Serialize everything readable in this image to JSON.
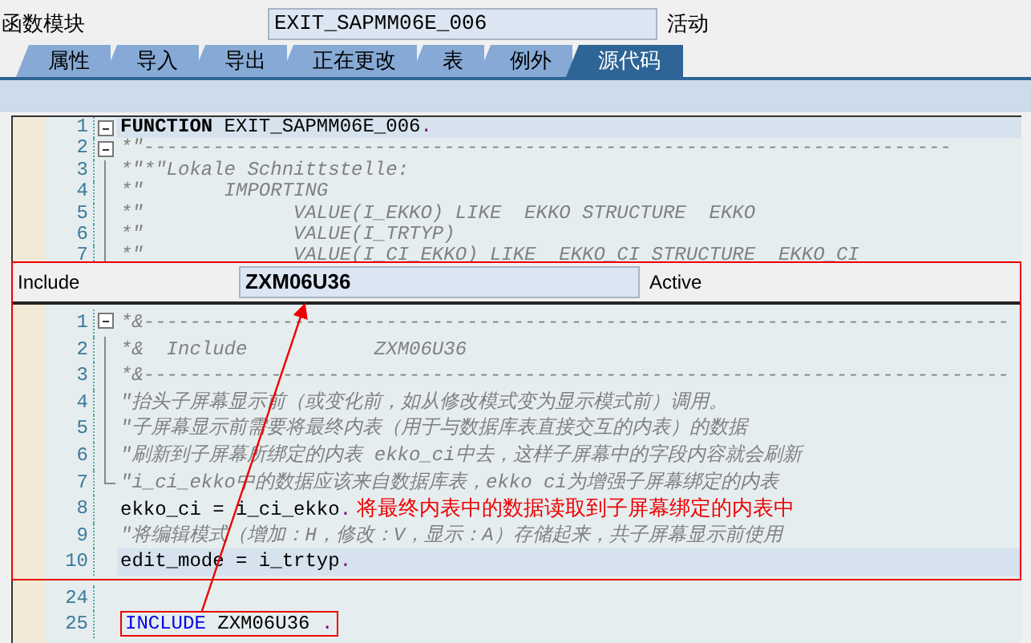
{
  "header": {
    "label": "函数模块",
    "value": "EXIT_SAPMM06E_006",
    "status": "活动"
  },
  "tabs": [
    {
      "label": "属性",
      "selected": false
    },
    {
      "label": "导入",
      "selected": false
    },
    {
      "label": "导出",
      "selected": false
    },
    {
      "label": "正在更改",
      "selected": false
    },
    {
      "label": "表",
      "selected": false
    },
    {
      "label": "例外",
      "selected": false
    },
    {
      "label": "源代码",
      "selected": true
    }
  ],
  "editor": {
    "lines": [
      {
        "number": "1",
        "kind": "foldstart",
        "highlighted": true,
        "segments": [
          {
            "kind": "keyword",
            "text": "FUNCTION"
          },
          {
            "kind": "plain",
            "text": " EXIT_SAPMM06E_006"
          },
          {
            "kind": "period",
            "text": "."
          }
        ]
      },
      {
        "number": "2",
        "kind": "foldstart",
        "highlighted": false,
        "segments": [
          {
            "kind": "comment",
            "text": "*\"----------------------------------------------------------------------"
          }
        ]
      },
      {
        "number": "3",
        "kind": "foldinner",
        "highlighted": false,
        "segments": [
          {
            "kind": "comment",
            "text": "*\"*\"Lokale Schnittstelle:"
          }
        ]
      },
      {
        "number": "4",
        "kind": "foldinner",
        "highlighted": false,
        "segments": [
          {
            "kind": "comment",
            "text": "*\"       IMPORTING"
          }
        ]
      },
      {
        "number": "5",
        "kind": "foldinner",
        "highlighted": false,
        "segments": [
          {
            "kind": "comment",
            "text": "*\"             VALUE(I_EKKO) LIKE  EKKO STRUCTURE  EKKO"
          }
        ]
      },
      {
        "number": "6",
        "kind": "foldinner",
        "highlighted": false,
        "segments": [
          {
            "kind": "comment",
            "text": "*\"             VALUE(I_TRTYP)"
          }
        ]
      },
      {
        "number": "7",
        "kind": "foldinner",
        "highlighted": false,
        "segments": [
          {
            "kind": "comment",
            "text": "*\"             VALUE(I_CI_EKKO) LIKE  EKKO_CI STRUCTURE  EKKO_CI"
          }
        ]
      }
    ]
  },
  "include_panel": {
    "label": "Include",
    "value": "ZXM06U36",
    "status": "Active",
    "lines": [
      {
        "number": "1",
        "kind": "foldstart",
        "highlighted": false,
        "segments": [
          {
            "kind": "comment",
            "text": "*&---------------------------------------------------------------------------"
          }
        ]
      },
      {
        "number": "2",
        "kind": "foldinner",
        "highlighted": false,
        "segments": [
          {
            "kind": "comment",
            "text": "*&  Include           ZXM06U36"
          }
        ]
      },
      {
        "number": "3",
        "kind": "foldinner",
        "highlighted": false,
        "segments": [
          {
            "kind": "comment",
            "text": "*&---------------------------------------------------------------------------"
          }
        ]
      },
      {
        "number": "4",
        "kind": "foldinner",
        "highlighted": false,
        "segments": [
          {
            "kind": "comment",
            "text": "\"抬头子屏幕显示前（或变化前，如从修改模式变为显示模式前）调用。"
          }
        ]
      },
      {
        "number": "5",
        "kind": "foldinner",
        "highlighted": false,
        "segments": [
          {
            "kind": "comment",
            "text": "\"子屏幕显示前需要将最终内表（用于与数据库表直接交互的内表）的数据"
          }
        ]
      },
      {
        "number": "6",
        "kind": "foldinner",
        "highlighted": false,
        "segments": [
          {
            "kind": "comment",
            "text": "\"刷新到子屏幕所绑定的内表 ekko_ci中去，这样子屏幕中的字段内容就会刷新"
          }
        ]
      },
      {
        "number": "7",
        "kind": "foldend",
        "highlighted": false,
        "segments": [
          {
            "kind": "comment",
            "text": "\"i_ci_ekko中的数据应该来自数据库表，ekko ci为增强子屏幕绑定的内表"
          }
        ]
      },
      {
        "number": "8",
        "highlighted": false,
        "segments": [
          {
            "kind": "plain",
            "text": "ekko_ci = i_ci_ekko"
          },
          {
            "kind": "period",
            "text": "."
          },
          {
            "kind": "annotation",
            "text": " 将最终内表中的数据读取到子屏幕绑定的内表中"
          }
        ]
      },
      {
        "number": "9",
        "highlighted": false,
        "segments": [
          {
            "kind": "comment",
            "text": "\"将编辑模式（增加：H，修改：V，显示：A）存储起来，共子屏幕显示前使用"
          }
        ]
      },
      {
        "number": "10",
        "highlighted": true,
        "segments": [
          {
            "kind": "plain",
            "text": "edit_mode = i_trtyp"
          },
          {
            "kind": "period",
            "text": "."
          }
        ]
      }
    ]
  },
  "bottom_lines": [
    {
      "number": "24",
      "highlighted": false
    },
    {
      "number": "25",
      "highlighted": false,
      "boxed": true,
      "segments": [
        {
          "kind": "include",
          "text": "INCLUDE"
        },
        {
          "kind": "plain",
          "text": " ZXM06U36 "
        },
        {
          "kind": "period",
          "text": "."
        }
      ]
    }
  ]
}
